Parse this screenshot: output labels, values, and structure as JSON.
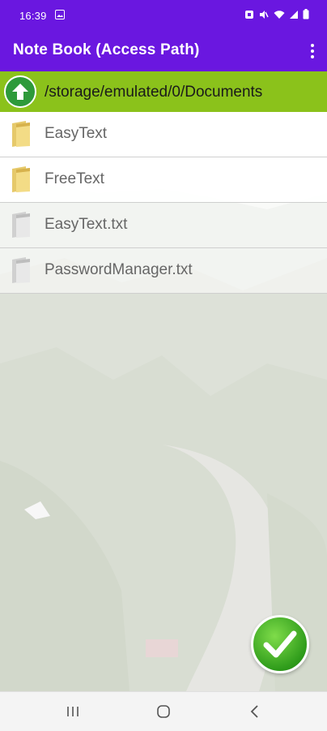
{
  "status_bar": {
    "time": "16:39"
  },
  "app_bar": {
    "title": "Note Book (Access Path)"
  },
  "path_bar": {
    "path": "/storage/emulated/0/Documents"
  },
  "entries": [
    {
      "name": "EasyText",
      "type": "folder"
    },
    {
      "name": "FreeText",
      "type": "folder"
    },
    {
      "name": "EasyText.txt",
      "type": "file"
    },
    {
      "name": "PasswordManager.txt",
      "type": "file"
    }
  ],
  "colors": {
    "primary": "#6a17e0",
    "path_bar": "#8bc21b",
    "up_button": "#2e9a3a",
    "confirm_button": "#2f9c1b"
  },
  "icons": {
    "folder": "folder-icon",
    "file": "file-icon",
    "up": "arrow-up-icon",
    "confirm": "checkmark-icon",
    "menu": "more-vert-icon"
  }
}
